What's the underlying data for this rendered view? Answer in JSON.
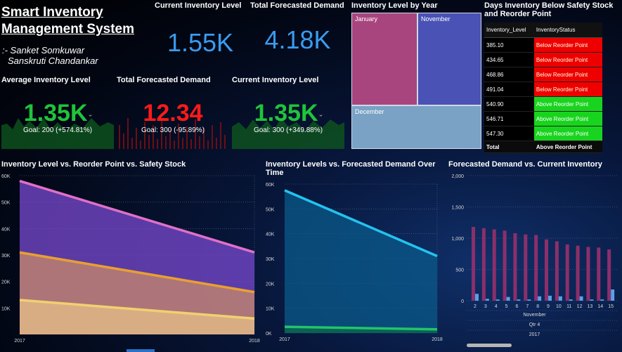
{
  "header": {
    "title": "Smart Inventory Management System",
    "authors_line1": ":- Sanket Somkuwar",
    "authors_line2": "Sanskruti Chandankar"
  },
  "cards": {
    "current_inventory": {
      "label": "Current Inventory Level",
      "value": "1.55K"
    },
    "total_forecasted": {
      "label": "Total Forecasted Demand",
      "value": "4.18K"
    }
  },
  "kpis": [
    {
      "label": "Average Inventory Level",
      "value": "1.35K",
      "goal": "Goal: 200 (+574.81%)",
      "color": "#1fc43a"
    },
    {
      "label": "Total Forecasted Demand",
      "value": "12.34",
      "goal": "Goal: 300 (-95.89%)",
      "color": "#ff1a1a"
    },
    {
      "label": "Current Inventory Level",
      "value": "1.35K",
      "goal": "Goal: 300 (+349.88%)",
      "color": "#1fc43a"
    }
  ],
  "treemap": {
    "title": "Inventory Level by Year",
    "cells": [
      {
        "label": "January",
        "color": "#a9457e"
      },
      {
        "label": "November",
        "color": "#4a52b5"
      },
      {
        "label": "December",
        "color": "#7aa2c4"
      }
    ]
  },
  "table": {
    "title": "Days Inventory Below Safety Stock and Reorder Point",
    "col1": "Inventory_Level",
    "col2": "InventoryStatus",
    "rows": [
      {
        "value": "385.10",
        "status": "Below Reorder Point",
        "kind": "red"
      },
      {
        "value": "434.65",
        "status": "Below Reorder Point",
        "kind": "red"
      },
      {
        "value": "468.86",
        "status": "Below Reorder Point",
        "kind": "red"
      },
      {
        "value": "491.04",
        "status": "Below Reorder Point",
        "kind": "red"
      },
      {
        "value": "540.90",
        "status": "Above Reorder Point",
        "kind": "green"
      },
      {
        "value": "546.71",
        "status": "Above Reorder Point",
        "kind": "green"
      },
      {
        "value": "547.30",
        "status": "Above Reorder Point",
        "kind": "green"
      }
    ],
    "total_label": "Total",
    "total_status": "Above Reorder Point"
  },
  "charts": {
    "area1_title": "Inventory Level vs. Reorder Point vs. Safety Stock",
    "area2_title": "Inventory Levels vs. Forecasted Demand Over Time",
    "bar_title": "Forecasted Demand vs. Current Inventory",
    "bar_x_group1": "November",
    "bar_x_group2": "Qtr 4",
    "bar_x_group3": "2017"
  },
  "chart_data": [
    {
      "type": "area",
      "x": [
        "2017",
        "2018"
      ],
      "ylim": [
        0,
        60000
      ],
      "yticks": [
        "60K",
        "50K",
        "40K",
        "30K",
        "20K",
        "10K"
      ],
      "series": [
        {
          "values": [
            58000,
            31000
          ],
          "color": "#e070c8"
        },
        {
          "values": [
            31000,
            16000
          ],
          "color": "#e8a030"
        },
        {
          "values": [
            13000,
            6000
          ],
          "color": "#f0d070"
        }
      ]
    },
    {
      "type": "area",
      "x": [
        "2017",
        "2018"
      ],
      "ylim": [
        0,
        60000
      ],
      "yticks": [
        "60K",
        "50K",
        "40K",
        "30K",
        "20K",
        "10K",
        "0K"
      ],
      "series": [
        {
          "values": [
            57500,
            31000
          ],
          "color": "#22c4f0"
        },
        {
          "values": [
            2500,
            1500
          ],
          "color": "#22c46a"
        }
      ]
    },
    {
      "type": "bar",
      "categories": [
        "2",
        "3",
        "4",
        "5",
        "6",
        "7",
        "8",
        "9",
        "10",
        "11",
        "12",
        "13",
        "14",
        "15"
      ],
      "ylim": [
        0,
        2000
      ],
      "yticks": [
        "2,000",
        "1,500",
        "1,000",
        "500",
        "0"
      ],
      "series": [
        {
          "values": [
            1180,
            1160,
            1140,
            1120,
            1080,
            1060,
            1050,
            980,
            950,
            900,
            880,
            860,
            850,
            820
          ],
          "color": "#8c2f6a"
        },
        {
          "values": [
            110,
            30,
            20,
            60,
            20,
            20,
            70,
            80,
            70,
            20,
            70,
            20,
            20,
            180
          ],
          "color": "#5aa0e6"
        }
      ]
    }
  ]
}
